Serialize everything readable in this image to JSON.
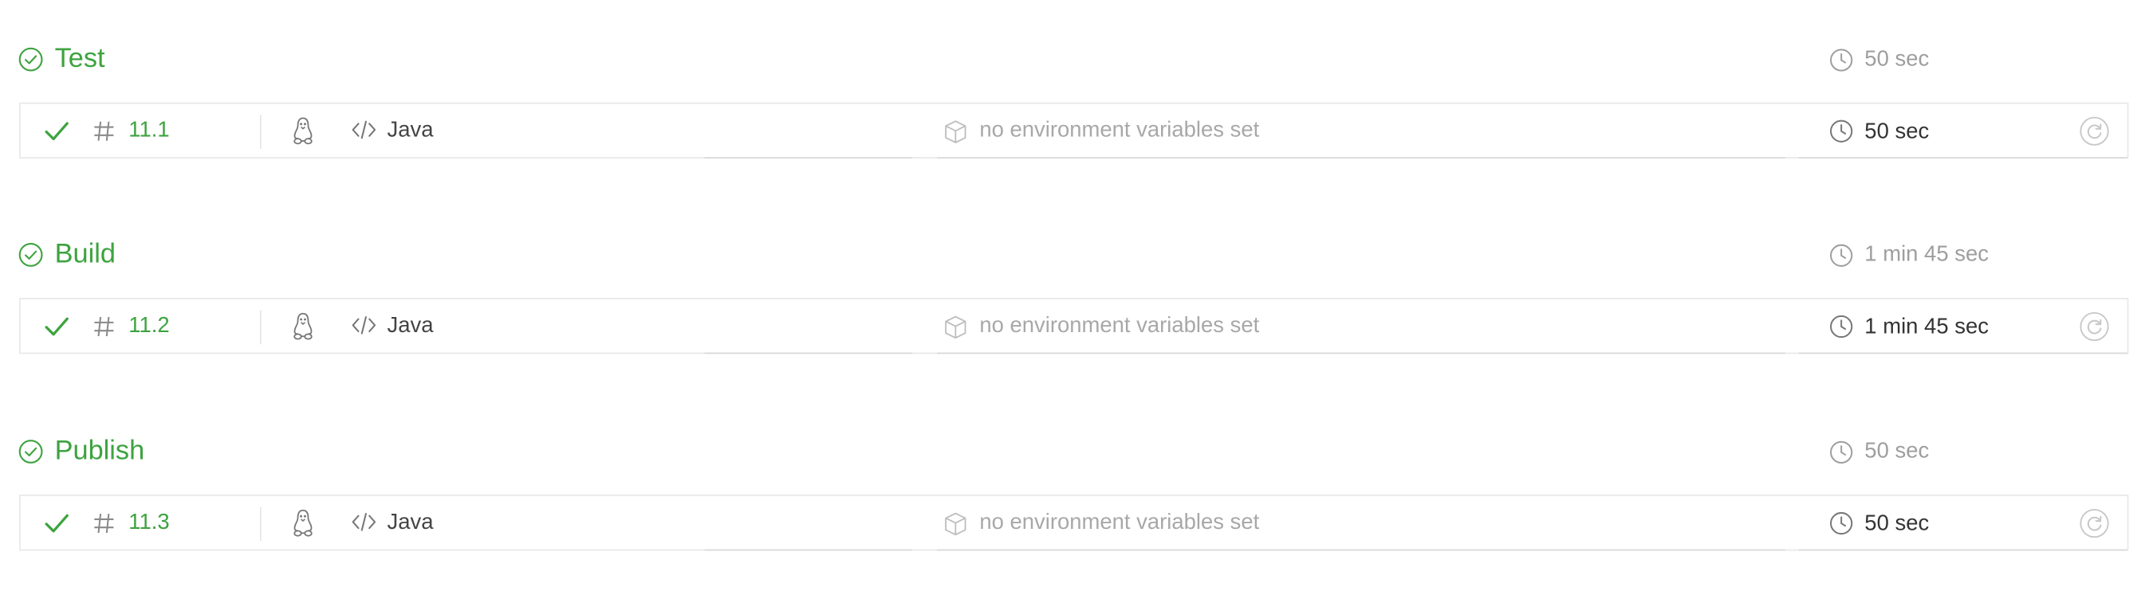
{
  "stages": [
    {
      "title": "Test",
      "duration": "50 sec",
      "job": {
        "number": "11.1",
        "language": "Java",
        "env": "no environment variables set",
        "duration": "50 sec"
      }
    },
    {
      "title": "Build",
      "duration": "1 min 45 sec",
      "job": {
        "number": "11.2",
        "language": "Java",
        "env": "no environment variables set",
        "duration": "1 min 45 sec"
      }
    },
    {
      "title": "Publish",
      "duration": "50 sec",
      "job": {
        "number": "11.3",
        "language": "Java",
        "env": "no environment variables set",
        "duration": "50 sec"
      }
    }
  ],
  "icons": {
    "stage_status": "check-circle-icon",
    "job_status": "check-icon",
    "job_number": "hash-icon",
    "os": "linux-icon",
    "language": "code-icon",
    "env": "cube-icon",
    "duration": "clock-icon",
    "restart": "restart-icon"
  },
  "colors": {
    "passed": "#3da33f",
    "muted": "#9e9e9e",
    "text": "#333333",
    "border": "#e8e8e8"
  }
}
